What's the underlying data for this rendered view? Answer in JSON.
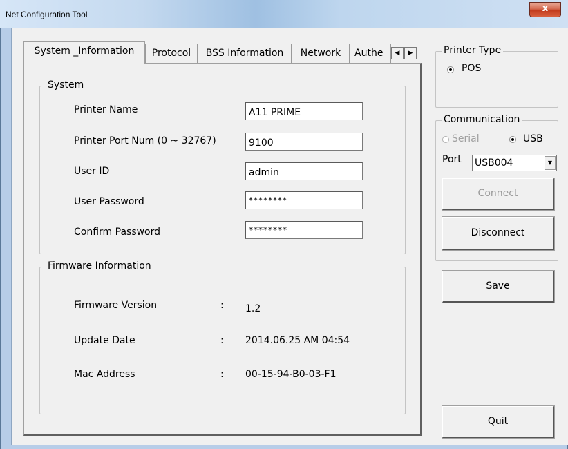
{
  "window": {
    "title": "Net Configuration Tool",
    "close_glyph": "x"
  },
  "tabs": [
    {
      "label": "System _Information"
    },
    {
      "label": "Protocol"
    },
    {
      "label": "BSS Information"
    },
    {
      "label": "Network"
    },
    {
      "label": "Authe"
    }
  ],
  "tab_scroll": {
    "left": "◀",
    "right": "▶"
  },
  "system": {
    "group_label": "System",
    "fields": [
      {
        "label": "Printer Name",
        "value": "A11 PRIME"
      },
      {
        "label": "Printer Port Num (0 ~ 32767)",
        "value": "9100"
      },
      {
        "label": "User ID",
        "value": "admin"
      },
      {
        "label": "User Password",
        "value": "********"
      },
      {
        "label": "Confirm Password",
        "value": "********"
      }
    ]
  },
  "firmware": {
    "group_label": "Firmware Information",
    "rows": [
      {
        "label": "Firmware Version",
        "sep": ":",
        "value": "1.2"
      },
      {
        "label": "Update Date",
        "sep": ":",
        "value": "2014.06.25 AM 04:54"
      },
      {
        "label": "Mac Address",
        "sep": ":",
        "value": "00-15-94-B0-03-F1"
      }
    ]
  },
  "printer_type": {
    "group_label": "Printer Type",
    "option": "POS"
  },
  "communication": {
    "group_label": "Communication",
    "serial_label": "Serial",
    "usb_label": "USB",
    "port_label": "Port",
    "port_value": "USB004",
    "port_arrow": "▼",
    "connect_label": "Connect",
    "disconnect_label": "Disconnect"
  },
  "buttons": {
    "save": "Save",
    "quit": "Quit"
  }
}
